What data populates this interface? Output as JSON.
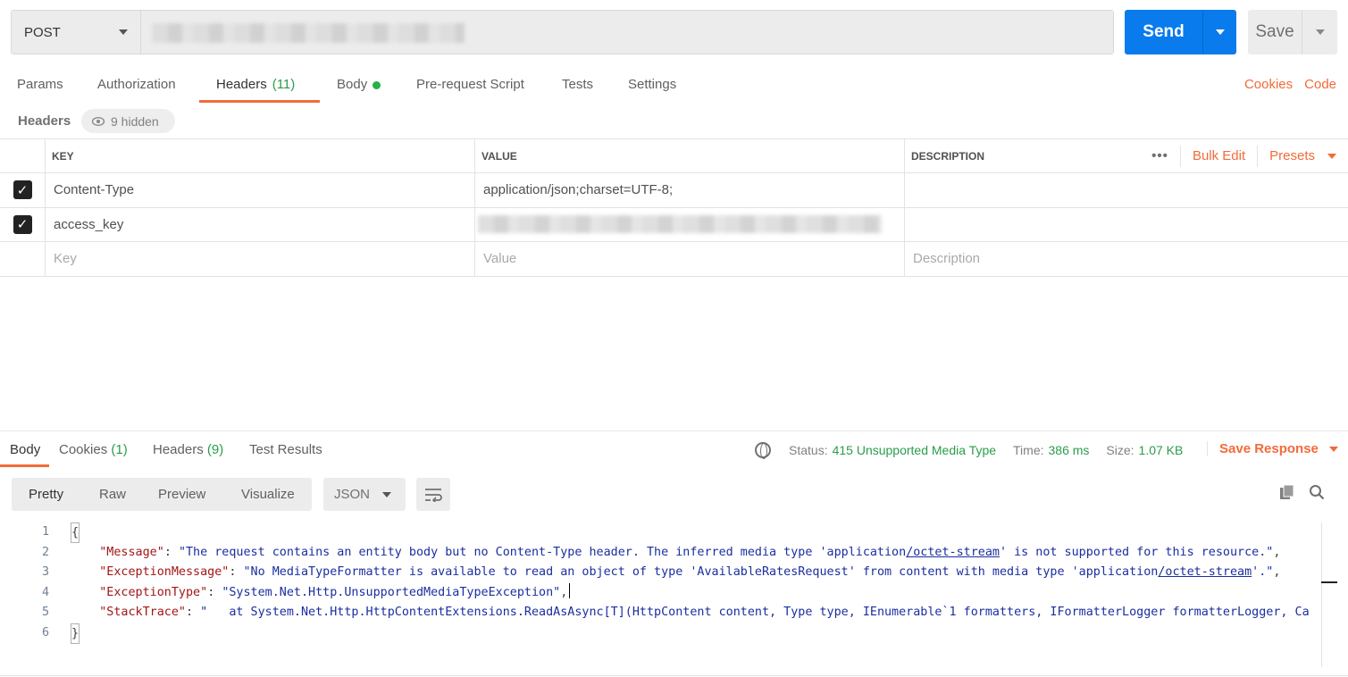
{
  "request": {
    "method": "POST",
    "send_label": "Send",
    "save_label": "Save"
  },
  "tabs": {
    "params": "Params",
    "authorization": "Authorization",
    "headers": "Headers",
    "headers_count": "(11)",
    "body": "Body",
    "prerequest": "Pre-request Script",
    "tests": "Tests",
    "settings": "Settings",
    "cookies": "Cookies",
    "code": "Code"
  },
  "headers_section": {
    "title": "Headers",
    "hidden": "9 hidden",
    "columns": {
      "key": "KEY",
      "value": "VALUE",
      "description": "DESCRIPTION"
    },
    "bulk_edit": "Bulk Edit",
    "presets": "Presets",
    "more": "•••",
    "rows": [
      {
        "key": "Content-Type",
        "value": "application/json;charset=UTF-8;",
        "description": ""
      },
      {
        "key": "access_key",
        "value": "",
        "description": ""
      }
    ],
    "placeholder": {
      "key": "Key",
      "value": "Value",
      "description": "Description"
    }
  },
  "response": {
    "tabs": {
      "body": "Body",
      "cookies": "Cookies",
      "cookies_count": "(1)",
      "headers": "Headers",
      "headers_count": "(9)",
      "test_results": "Test Results"
    },
    "status_label": "Status:",
    "status": "415 Unsupported Media Type",
    "time_label": "Time:",
    "time": "386 ms",
    "size_label": "Size:",
    "size": "1.07 KB",
    "save_response": "Save Response",
    "views": {
      "pretty": "Pretty",
      "raw": "Raw",
      "preview": "Preview",
      "visualize": "Visualize"
    },
    "format": "JSON",
    "lines": [
      "1",
      "2",
      "3",
      "4",
      "5",
      "6"
    ],
    "code": {
      "open": "{",
      "close": "}",
      "k_message": "\"Message\"",
      "v_message_a": "\"The request contains an entity body but no Content-Type header. The inferred media type 'application",
      "v_message_u": "/octet-stream",
      "v_message_b": "' is not supported for this resource.\"",
      "k_exmsg": "\"ExceptionMessage\"",
      "v_exmsg_a": "\"No MediaTypeFormatter is available to read an object of type 'AvailableRatesRequest' from content with media type 'application",
      "v_exmsg_u": "/octet-stream",
      "v_exmsg_b": "'.\"",
      "k_extype": "\"ExceptionType\"",
      "v_extype": "\"System.Net.Http.UnsupportedMediaTypeException\"",
      "k_stack": "\"StackTrace\"",
      "v_stack": "\"   at System.Net.Http.HttpContentExtensions.ReadAsAsync[T](HttpContent content, Type type, IEnumerable`1 formatters, IFormatterLogger formatterLogger, Ca"
    }
  }
}
